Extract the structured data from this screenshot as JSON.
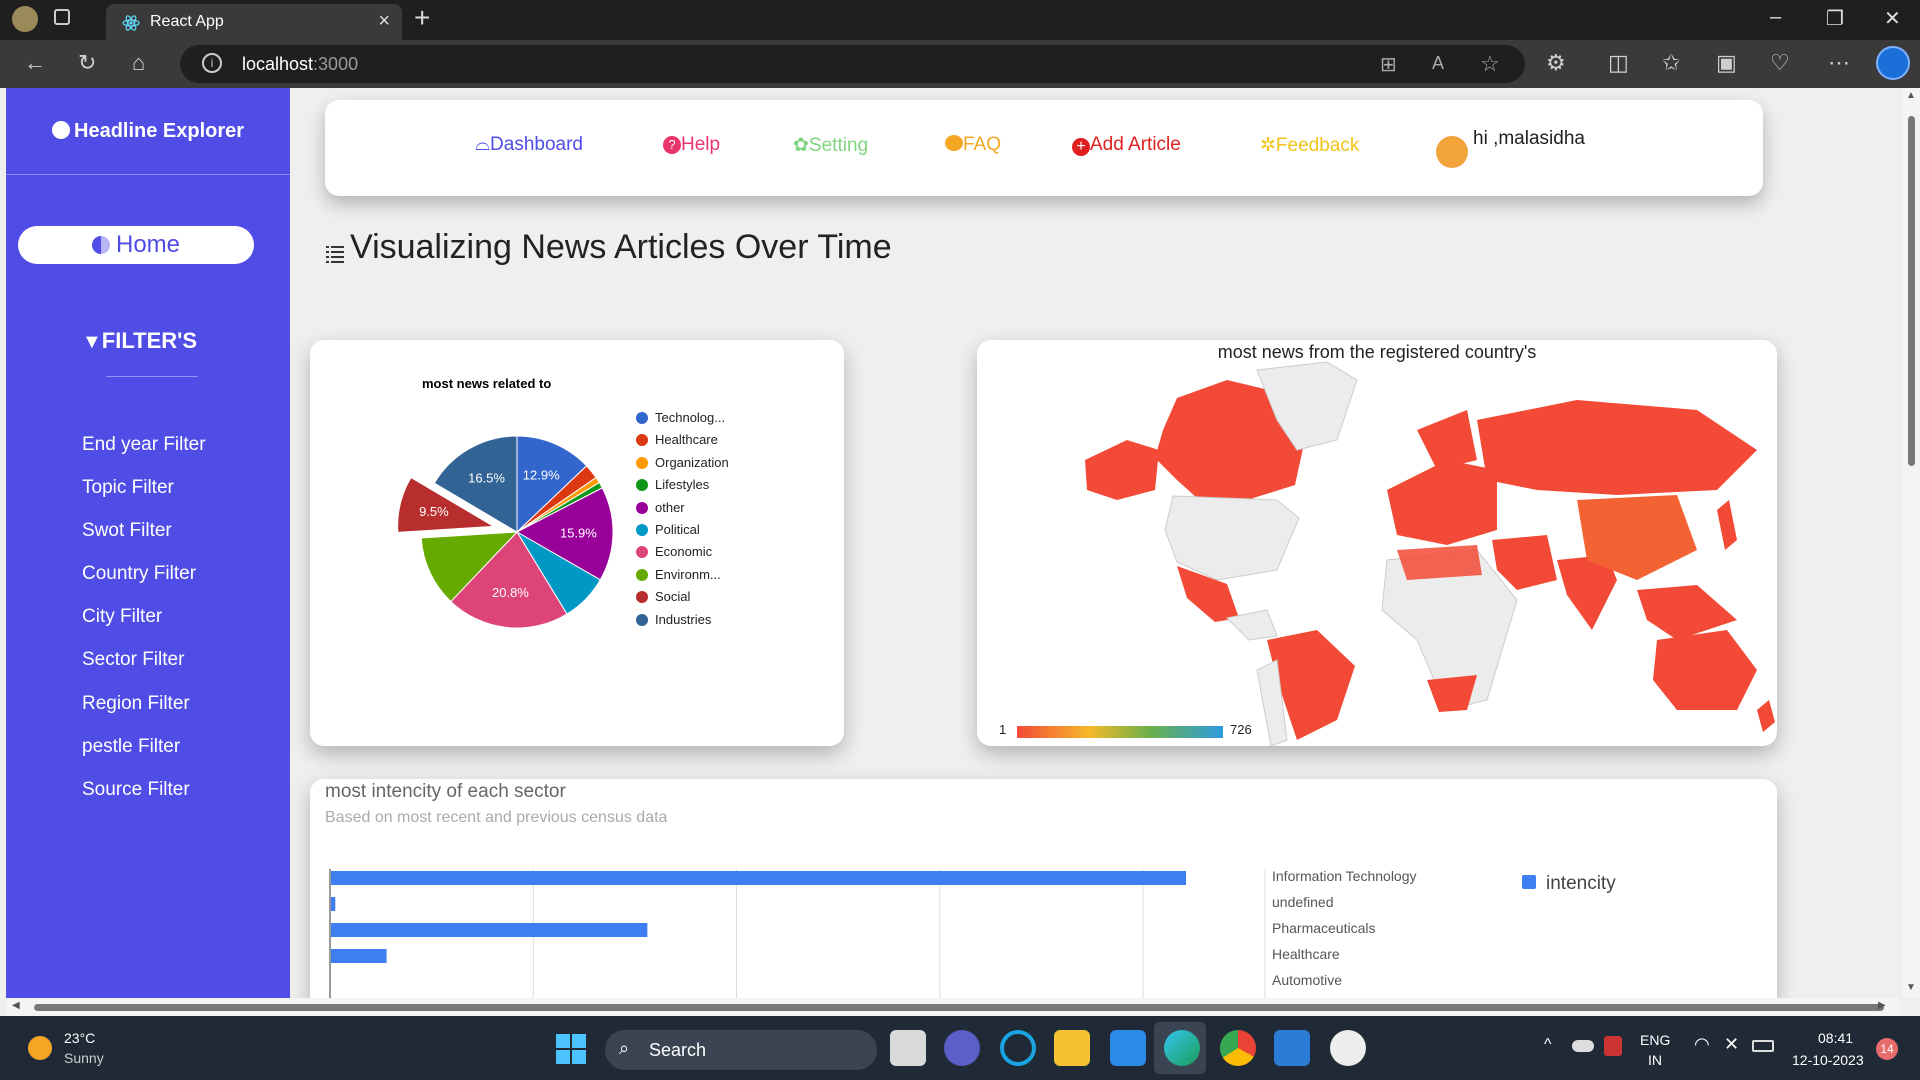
{
  "browser": {
    "tab_title": "React App",
    "url_host": "localhost",
    "url_port": ":3000"
  },
  "sidebar": {
    "brand": "Headline Explorer",
    "home": "Home",
    "filters_title": "FILTER'S",
    "items": [
      {
        "label": "End year Filter"
      },
      {
        "label": "Topic Filter"
      },
      {
        "label": "Swot Filter"
      },
      {
        "label": "Country Filter"
      },
      {
        "label": "City Filter"
      },
      {
        "label": "Sector Filter"
      },
      {
        "label": "Region Filter"
      },
      {
        "label": "pestle Filter"
      },
      {
        "label": "Source Filter"
      }
    ]
  },
  "nav": {
    "dashboard": "Dashboard",
    "help": "Help",
    "setting": "Setting",
    "faq": "FAQ",
    "add_article": "Add Article",
    "feedback": "Feedback",
    "greeting": "hi ,malasidha"
  },
  "page_title": "Visualizing News Articles Over Time",
  "chart_data": [
    {
      "type": "pie",
      "title": "most news related to",
      "categories": [
        "Technolog...",
        "Healthcare",
        "Organization",
        "Lifestyles",
        "other",
        "Political",
        "Economic",
        "Environm...",
        "Social",
        "Industries"
      ],
      "values": [
        12.9,
        2.5,
        1.0,
        1.0,
        15.9,
        8.0,
        20.8,
        11.9,
        9.5,
        16.5
      ],
      "labels_shown": [
        "12.9%",
        "",
        "",
        "",
        "15.9%",
        "",
        "20.8%",
        "",
        "9.5%",
        "16.5%"
      ],
      "colors": [
        "#3366cc",
        "#dc3912",
        "#ff9900",
        "#109618",
        "#990099",
        "#0099c6",
        "#dd4477",
        "#66aa00",
        "#b82e2e",
        "#316395"
      ],
      "legend": "right"
    },
    {
      "type": "heatmap",
      "title": "most news from the registered country's",
      "color_scale_min": "1",
      "color_scale_max": "726"
    },
    {
      "type": "bar",
      "title": "most intencity of each sector",
      "subtitle": "Based on most recent and previous census data",
      "categories": [
        "Information Technology",
        "undefined",
        "Pharmaceuticals",
        "Healthcare",
        "Automotive"
      ],
      "series": [
        {
          "name": "intencity",
          "values": [
            100,
            0.5,
            37,
            6.5,
            0
          ]
        }
      ],
      "legend": "right"
    }
  ],
  "taskbar": {
    "temp": "23°C",
    "weather": "Sunny",
    "search": "Search",
    "lang1": "ENG",
    "lang2": "IN",
    "time": "08:41",
    "date": "12-10-2023",
    "notif": "14"
  }
}
